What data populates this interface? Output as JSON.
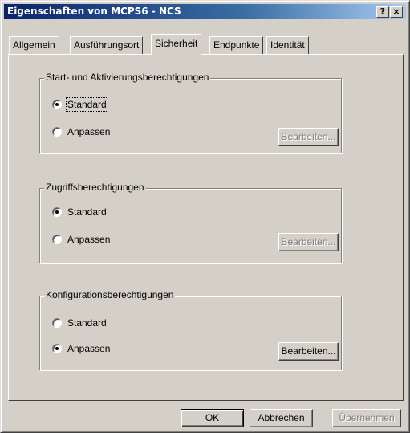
{
  "window": {
    "title": "Eigenschaften von MCPS6 - NCS",
    "help_label": "?",
    "close_label": "×"
  },
  "tabs": [
    {
      "label": "Allgemein"
    },
    {
      "label": "Ausführungsort"
    },
    {
      "label": "Sicherheit",
      "active": true
    },
    {
      "label": "Endpunkte"
    },
    {
      "label": "Identität"
    }
  ],
  "groups": {
    "launch": {
      "title": "Start- und Aktivierungsberechtigungen",
      "standard_label": "Standard",
      "custom_label": "Anpassen",
      "selected": "standard",
      "edit_label": "Bearbeiten...",
      "edit_enabled": false
    },
    "access": {
      "title": "Zugriffsberechtigungen",
      "standard_label": "Standard",
      "custom_label": "Anpassen",
      "selected": "standard",
      "edit_label": "Bearbeiten...",
      "edit_enabled": false
    },
    "config": {
      "title": "Konfigurationsberechtigungen",
      "standard_label": "Standard",
      "custom_label": "Anpassen",
      "selected": "custom",
      "edit_label": "Bearbeiten...",
      "edit_enabled": true
    }
  },
  "footer": {
    "ok_label": "OK",
    "cancel_label": "Abbrechen",
    "apply_label": "Übernehmen",
    "apply_enabled": false
  }
}
